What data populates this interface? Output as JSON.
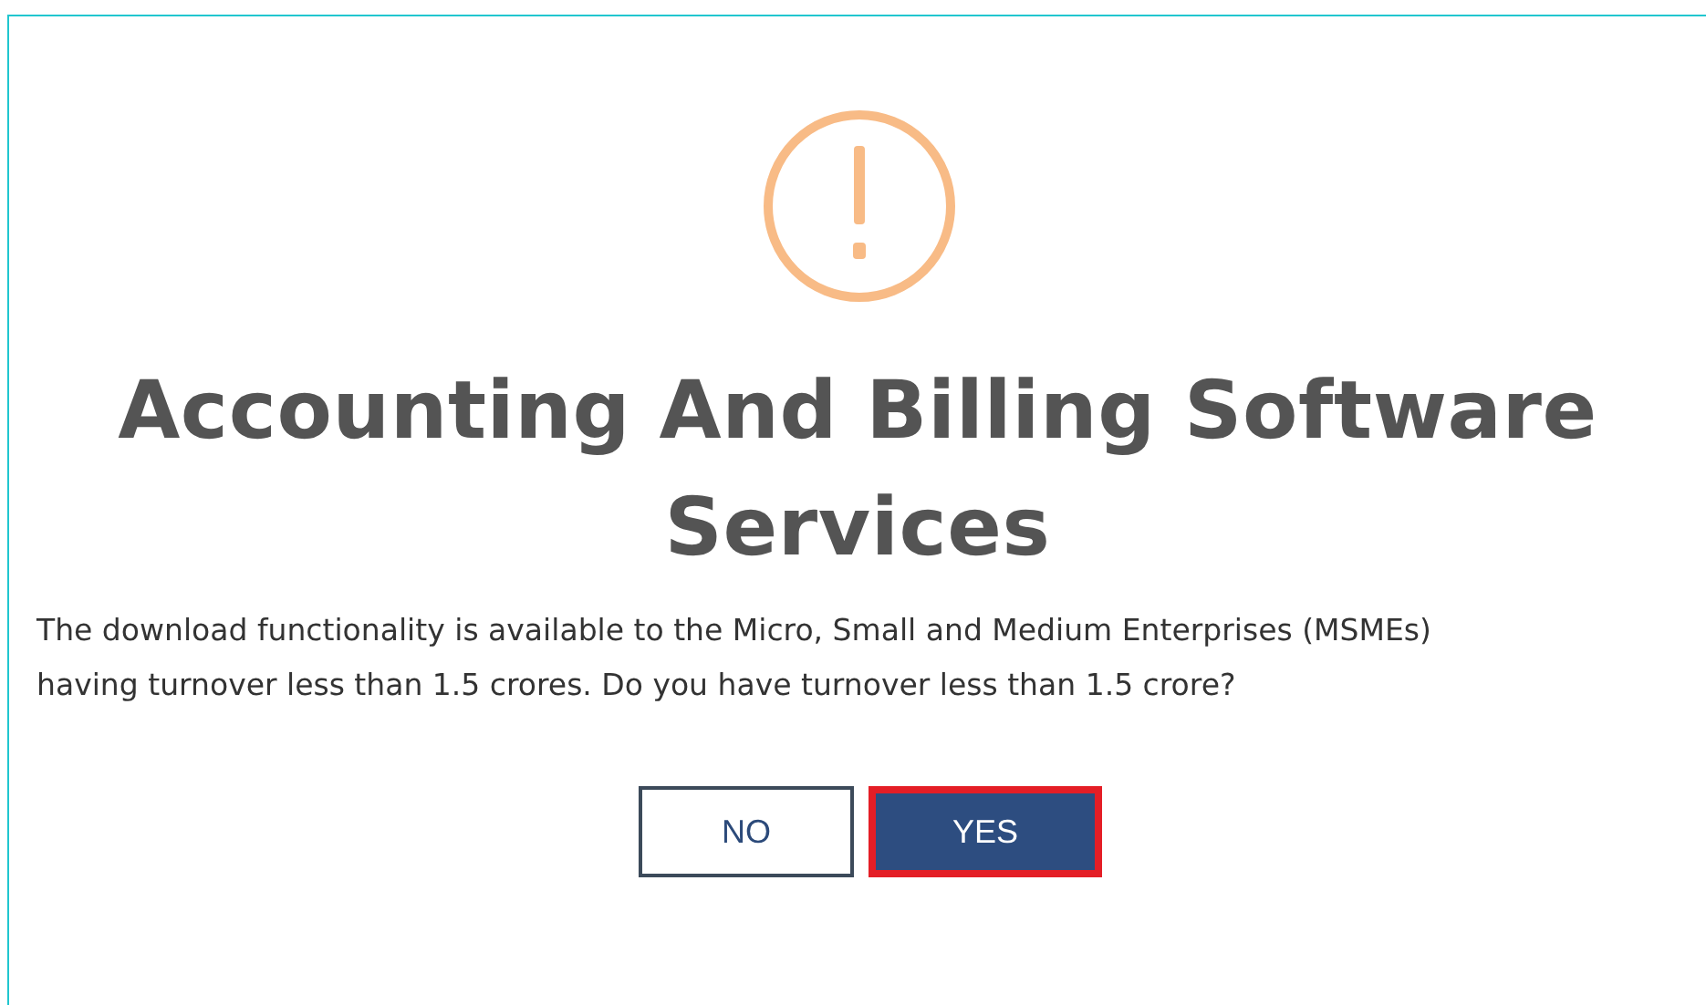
{
  "dialog": {
    "title": "Accounting And Billing Software Services",
    "message": "The download functionality is available to the Micro, Small and Medium Enterprises (MSMEs) having turnover less than 1.5 crores. Do you have turnover less than 1.5 crore?",
    "buttons": [
      {
        "label": "NO",
        "kind": "secondary",
        "highlighted": false
      },
      {
        "label": "YES",
        "kind": "primary",
        "highlighted": true
      }
    ]
  }
}
